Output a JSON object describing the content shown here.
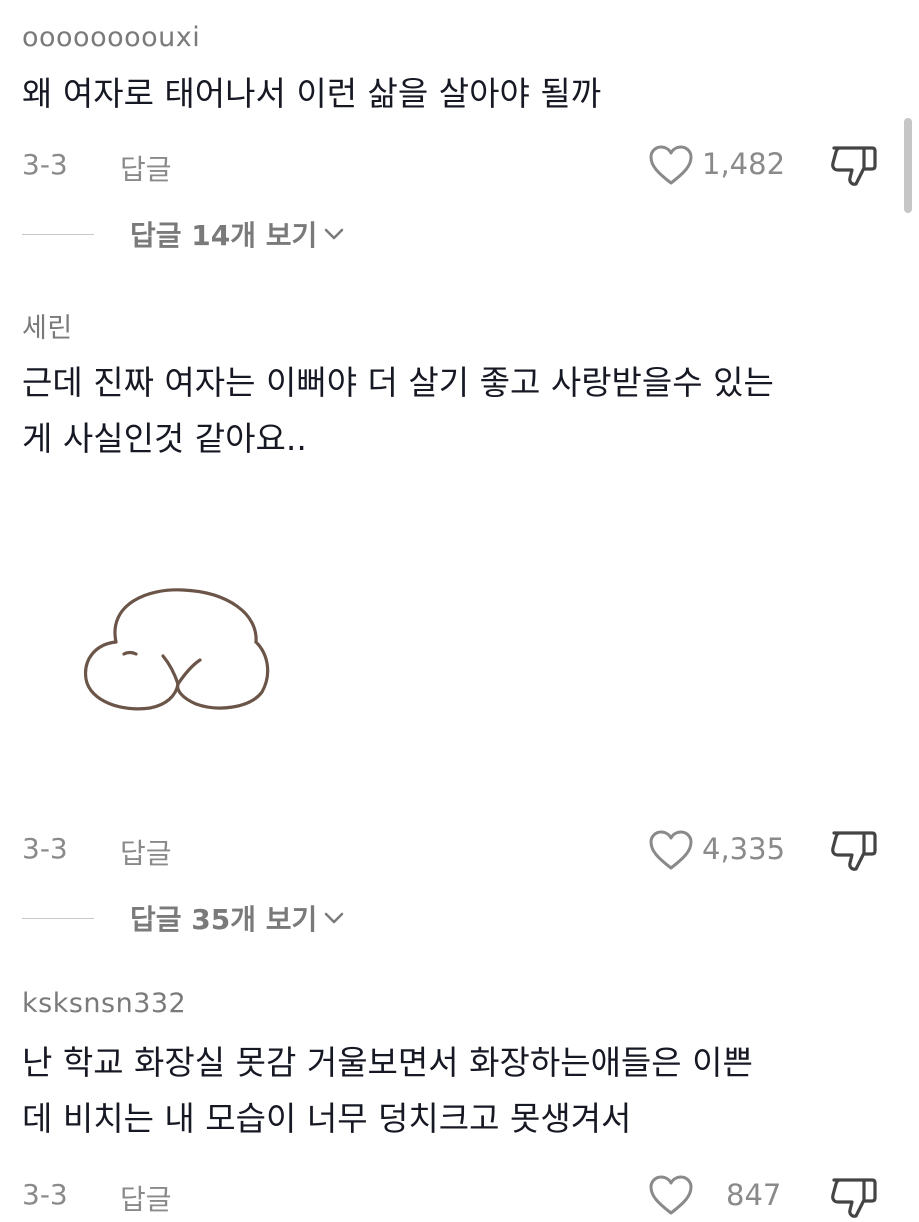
{
  "comments": [
    {
      "username": "oooooooouxi",
      "lines": [
        "왜 여자로 태어나서 이런 삶을 살아야 될까"
      ],
      "date": "3-3",
      "reply_label": "답글",
      "likes": "1,482",
      "view_replies": "답글 14개 보기"
    },
    {
      "username": "세린",
      "lines": [
        "근데 진짜 여자는 이뻐야 더 살기 좋고 사랑받을수 있는",
        "게 사실인것 같아요.."
      ],
      "date": "3-3",
      "reply_label": "답글",
      "likes": "4,335",
      "view_replies": "답글 35개 보기",
      "sticker": "cartoon-butt-sticker"
    },
    {
      "username": "ksksnsn332",
      "lines": [
        "난 학교 화장실 못감 거울보면서 화장하는애들은 이쁜",
        "데 비치는 내 모습이 너무 덩치크고 못생겨서"
      ],
      "date": "3-3",
      "reply_label": "답글",
      "likes": "847"
    }
  ],
  "icons": {
    "like": "heart-outline-icon",
    "dislike": "thumbs-down-outline-icon",
    "expand": "chevron-down-icon"
  },
  "colors": {
    "text": "#161823",
    "secondary": "#8a8a8a",
    "background": "#ffffff"
  }
}
